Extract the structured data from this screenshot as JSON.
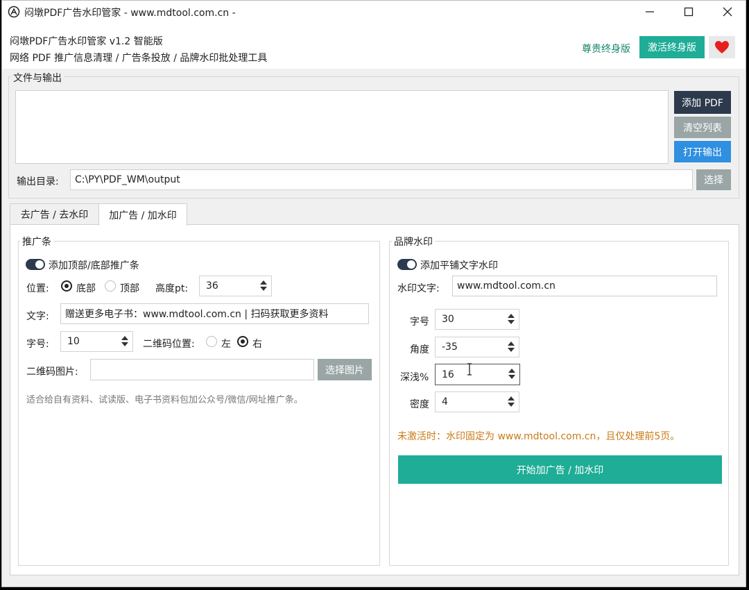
{
  "window": {
    "title": "闷墩PDF广告水印管家 - www.mdtool.com.cn -",
    "icon": "app-logo-icon"
  },
  "header": {
    "line1": "闷墩PDF广告水印管家  v1.2 智能版",
    "line2": "网络 PDF 推广信息清理 / 广告条投放 / 品牌水印批处理工具",
    "premium_label": "尊贵终身版",
    "activate_label": "激活终身版",
    "heart_icon": "heart-icon"
  },
  "files": {
    "group_title": "文件与输出",
    "add_pdf": "添加 PDF",
    "clear_list": "清空列表",
    "open_output": "打开输出",
    "output_label": "输出目录:",
    "output_path": "C:\\PY\\PDF_WM\\output",
    "choose": "选择"
  },
  "tabs": [
    {
      "label": "去广告 / 去水印",
      "active": false
    },
    {
      "label": "加广告 / 加水印",
      "active": true
    }
  ],
  "promo": {
    "group_title": "推广条",
    "toggle_label": "添加顶部/底部推广条",
    "position_label": "位置:",
    "position_bottom": "底部",
    "position_top": "顶部",
    "height_label": "高度pt:",
    "height_value": "36",
    "text_label": "文字:",
    "text_value": "赠送更多电子书：www.mdtool.com.cn | 扫码获取更多资料",
    "fontsize_label": "字号:",
    "fontsize_value": "10",
    "qr_position_label": "二维码位置:",
    "qr_left": "左",
    "qr_right": "右",
    "qr_image_label": "二维码图片:",
    "qr_image_value": "",
    "choose_image": "选择图片",
    "hint": "适合给自有资料、试读版、电子书资料包加公众号/微信/网址推广条。"
  },
  "watermark": {
    "group_title": "品牌水印",
    "toggle_label": "添加平铺文字水印",
    "text_label": "水印文字:",
    "text_value": "www.mdtool.com.cn",
    "fontsize_label": "字号",
    "fontsize_value": "30",
    "angle_label": "角度",
    "angle_value": "-35",
    "depth_label": "深浅%",
    "depth_value": "16",
    "density_label": "密度",
    "density_value": "4",
    "notice": "未激活时：水印固定为 www.mdtool.com.cn，且仅处理前5页。",
    "start_button": "开始加广告 / 加水印"
  },
  "colors": {
    "accent": "#1fad97",
    "dark_button": "#2c3a4c",
    "gray_button": "#9aa5a5",
    "blue_button": "#2f8fe0",
    "premium_text": "#17866a",
    "notice_text": "#c97b16",
    "heart": "#e81f1f"
  }
}
